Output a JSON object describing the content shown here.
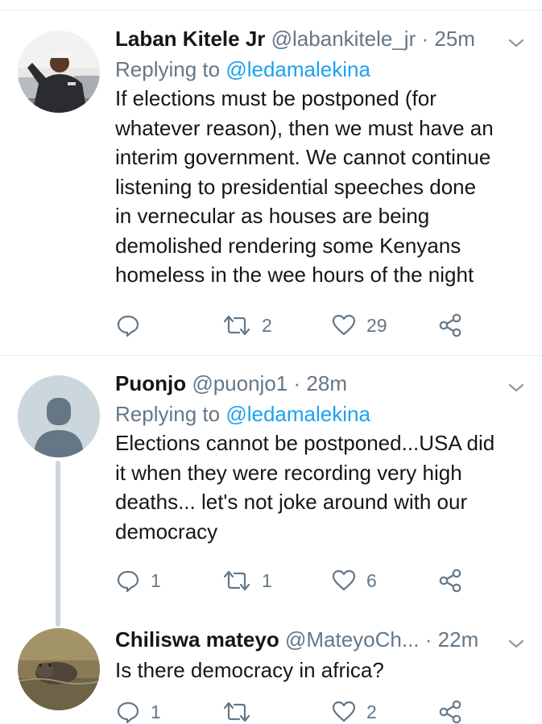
{
  "tweets": [
    {
      "name": "Laban Kitele Jr",
      "handle": "@labankitele_jr",
      "separator": "·",
      "time": "25m",
      "replying_prefix": "Replying to",
      "replying_to": "@ledamalekina",
      "text_lines": [
        "If elections must be postponed (for",
        "whatever reason), then we must have an",
        "interim government. We cannot continue",
        "listening to presidential speeches done",
        "in vernecular as houses are being",
        "demolished rendering some Kenyans",
        "homeless in the wee hours of the night"
      ],
      "replies": "",
      "retweets": "2",
      "likes": "29"
    },
    {
      "name": "Puonjo",
      "handle": "@puonjo1",
      "separator": "·",
      "time": "28m",
      "replying_prefix": "Replying to",
      "replying_to": "@ledamalekina",
      "text_lines": [
        "Elections cannot be postponed...USA did",
        "it when they were recording very high",
        "deaths... let's not joke around with our",
        "democracy"
      ],
      "replies": "1",
      "retweets": "1",
      "likes": "6"
    },
    {
      "name": "Chiliswa mateyo",
      "handle": "@MateyoCh...",
      "separator": "·",
      "time": "22m",
      "text_lines": [
        "Is there democracy in africa?"
      ],
      "replies": "1",
      "retweets": "",
      "likes": "2"
    }
  ],
  "icons": {
    "reply": "reply-icon",
    "retweet": "retweet-icon",
    "like": "heart-icon",
    "share": "share-icon",
    "menu": "chevron-down-icon"
  },
  "colors": {
    "text": "#14171a",
    "secondary": "#657786",
    "link": "#1da1f2",
    "divider": "#e6ecf0",
    "thread": "#ccd6dd"
  }
}
